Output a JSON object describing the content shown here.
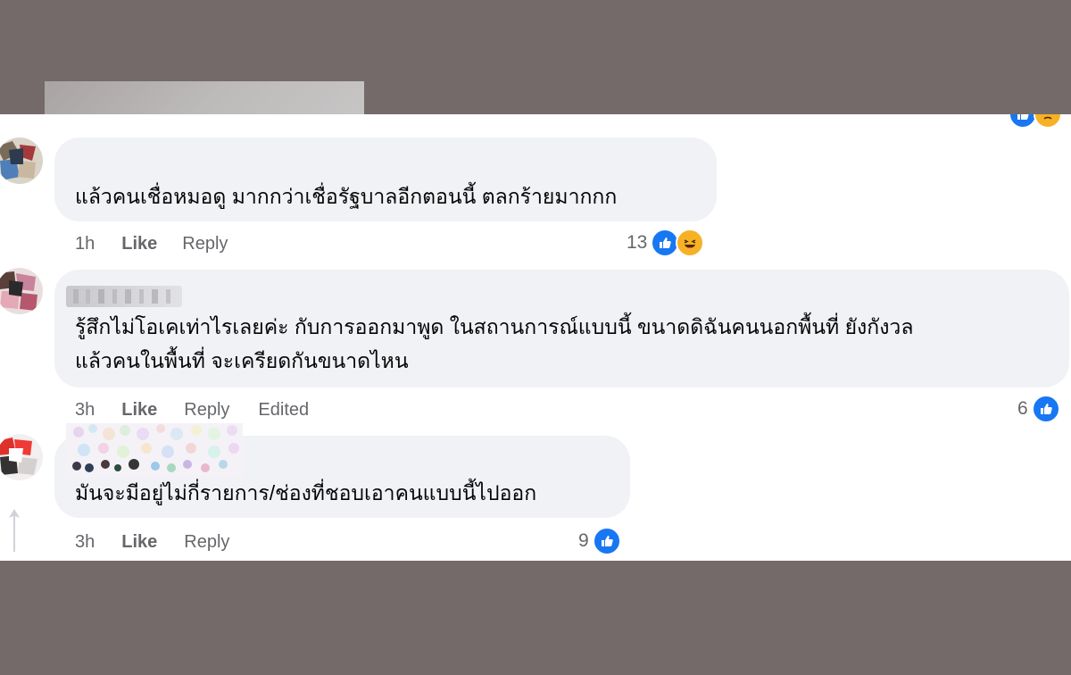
{
  "colors": {
    "backdrop": "#746a69",
    "panel": "#ffffff",
    "bubble": "#f0f2f5",
    "meta_text": "#65676b",
    "body_text": "#050505",
    "like_blue": "#1877f2",
    "haha_yellow": "#f7b125"
  },
  "comments": [
    {
      "text": "แล้วคนเชื่อหมอดู มากกว่าเชื่อรัฐบาลอีกตอนนี้ ตลกร้ายมากกก",
      "time": "1h",
      "like": "Like",
      "reply": "Reply",
      "reaction_count": "13",
      "reactions": [
        "like-icon",
        "haha-icon"
      ]
    },
    {
      "text_line1": "รู้สึกไม่โอเคเท่าไรเลยค่ะ กับการออกมาพูด ในสถานการณ์แบบนี้ ขนาดดิฉันคนนอกพื้นที่ ยังกังวล",
      "text_line2": "แล้วคนในพื้นที่ จะเครียดกันขนาดไหน",
      "time": "3h",
      "like": "Like",
      "reply": "Reply",
      "edited": "Edited",
      "reaction_count": "6",
      "reactions": [
        "like-icon"
      ]
    },
    {
      "text": "มันจะมีอยู่ไม่กี่รายการ/ช่องที่ชอบเอาคนแบบนี้ไปออก",
      "time": "3h",
      "like": "Like",
      "reply": "Reply",
      "reaction_count": "9",
      "reactions": [
        "like-icon"
      ]
    }
  ]
}
